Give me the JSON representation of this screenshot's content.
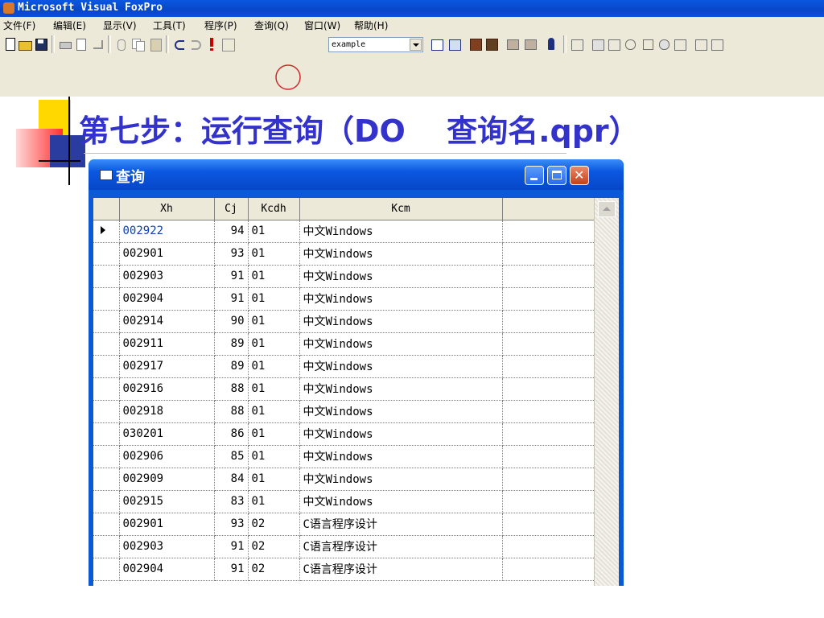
{
  "app": {
    "title": "Microsoft Visual FoxPro"
  },
  "menu": [
    {
      "label": "文件(F)"
    },
    {
      "label": "编辑(E)"
    },
    {
      "label": "显示(V)"
    },
    {
      "label": "工具(T)"
    },
    {
      "label": "程序(P)"
    },
    {
      "label": "查询(Q)"
    },
    {
      "label": "窗口(W)"
    },
    {
      "label": "帮助(H)"
    }
  ],
  "toolbar": {
    "database_combo": "example",
    "run_icon": "exclamation-icon"
  },
  "slide": {
    "title": "第七步：运行查询（DO　 查询名.qpr）"
  },
  "query_window": {
    "title": "查询",
    "columns": [
      "Xh",
      "Cj",
      "Kcdh",
      "Kcm",
      ""
    ],
    "rows": [
      {
        "xh": "002922",
        "cj": "94",
        "kcdh": "01",
        "kcm": "中文Windows"
      },
      {
        "xh": "002901",
        "cj": "93",
        "kcdh": "01",
        "kcm": "中文Windows"
      },
      {
        "xh": "002903",
        "cj": "91",
        "kcdh": "01",
        "kcm": "中文Windows"
      },
      {
        "xh": "002904",
        "cj": "91",
        "kcdh": "01",
        "kcm": "中文Windows"
      },
      {
        "xh": "002914",
        "cj": "90",
        "kcdh": "01",
        "kcm": "中文Windows"
      },
      {
        "xh": "002911",
        "cj": "89",
        "kcdh": "01",
        "kcm": "中文Windows"
      },
      {
        "xh": "002917",
        "cj": "89",
        "kcdh": "01",
        "kcm": "中文Windows"
      },
      {
        "xh": "002916",
        "cj": "88",
        "kcdh": "01",
        "kcm": "中文Windows"
      },
      {
        "xh": "002918",
        "cj": "88",
        "kcdh": "01",
        "kcm": "中文Windows"
      },
      {
        "xh": "030201",
        "cj": "86",
        "kcdh": "01",
        "kcm": "中文Windows"
      },
      {
        "xh": "002906",
        "cj": "85",
        "kcdh": "01",
        "kcm": "中文Windows"
      },
      {
        "xh": "002909",
        "cj": "84",
        "kcdh": "01",
        "kcm": "中文Windows"
      },
      {
        "xh": "002915",
        "cj": "83",
        "kcdh": "01",
        "kcm": "中文Windows"
      },
      {
        "xh": "002901",
        "cj": "93",
        "kcdh": "02",
        "kcm": "C语言程序设计"
      },
      {
        "xh": "002903",
        "cj": "91",
        "kcdh": "02",
        "kcm": "C语言程序设计"
      },
      {
        "xh": "002904",
        "cj": "91",
        "kcdh": "02",
        "kcm": "C语言程序设计"
      }
    ]
  },
  "colors": {
    "title_blue": "#3333cc",
    "xp_caption": "#0a58e0",
    "close_red": "#c8401a",
    "run_red": "#cc0000"
  }
}
